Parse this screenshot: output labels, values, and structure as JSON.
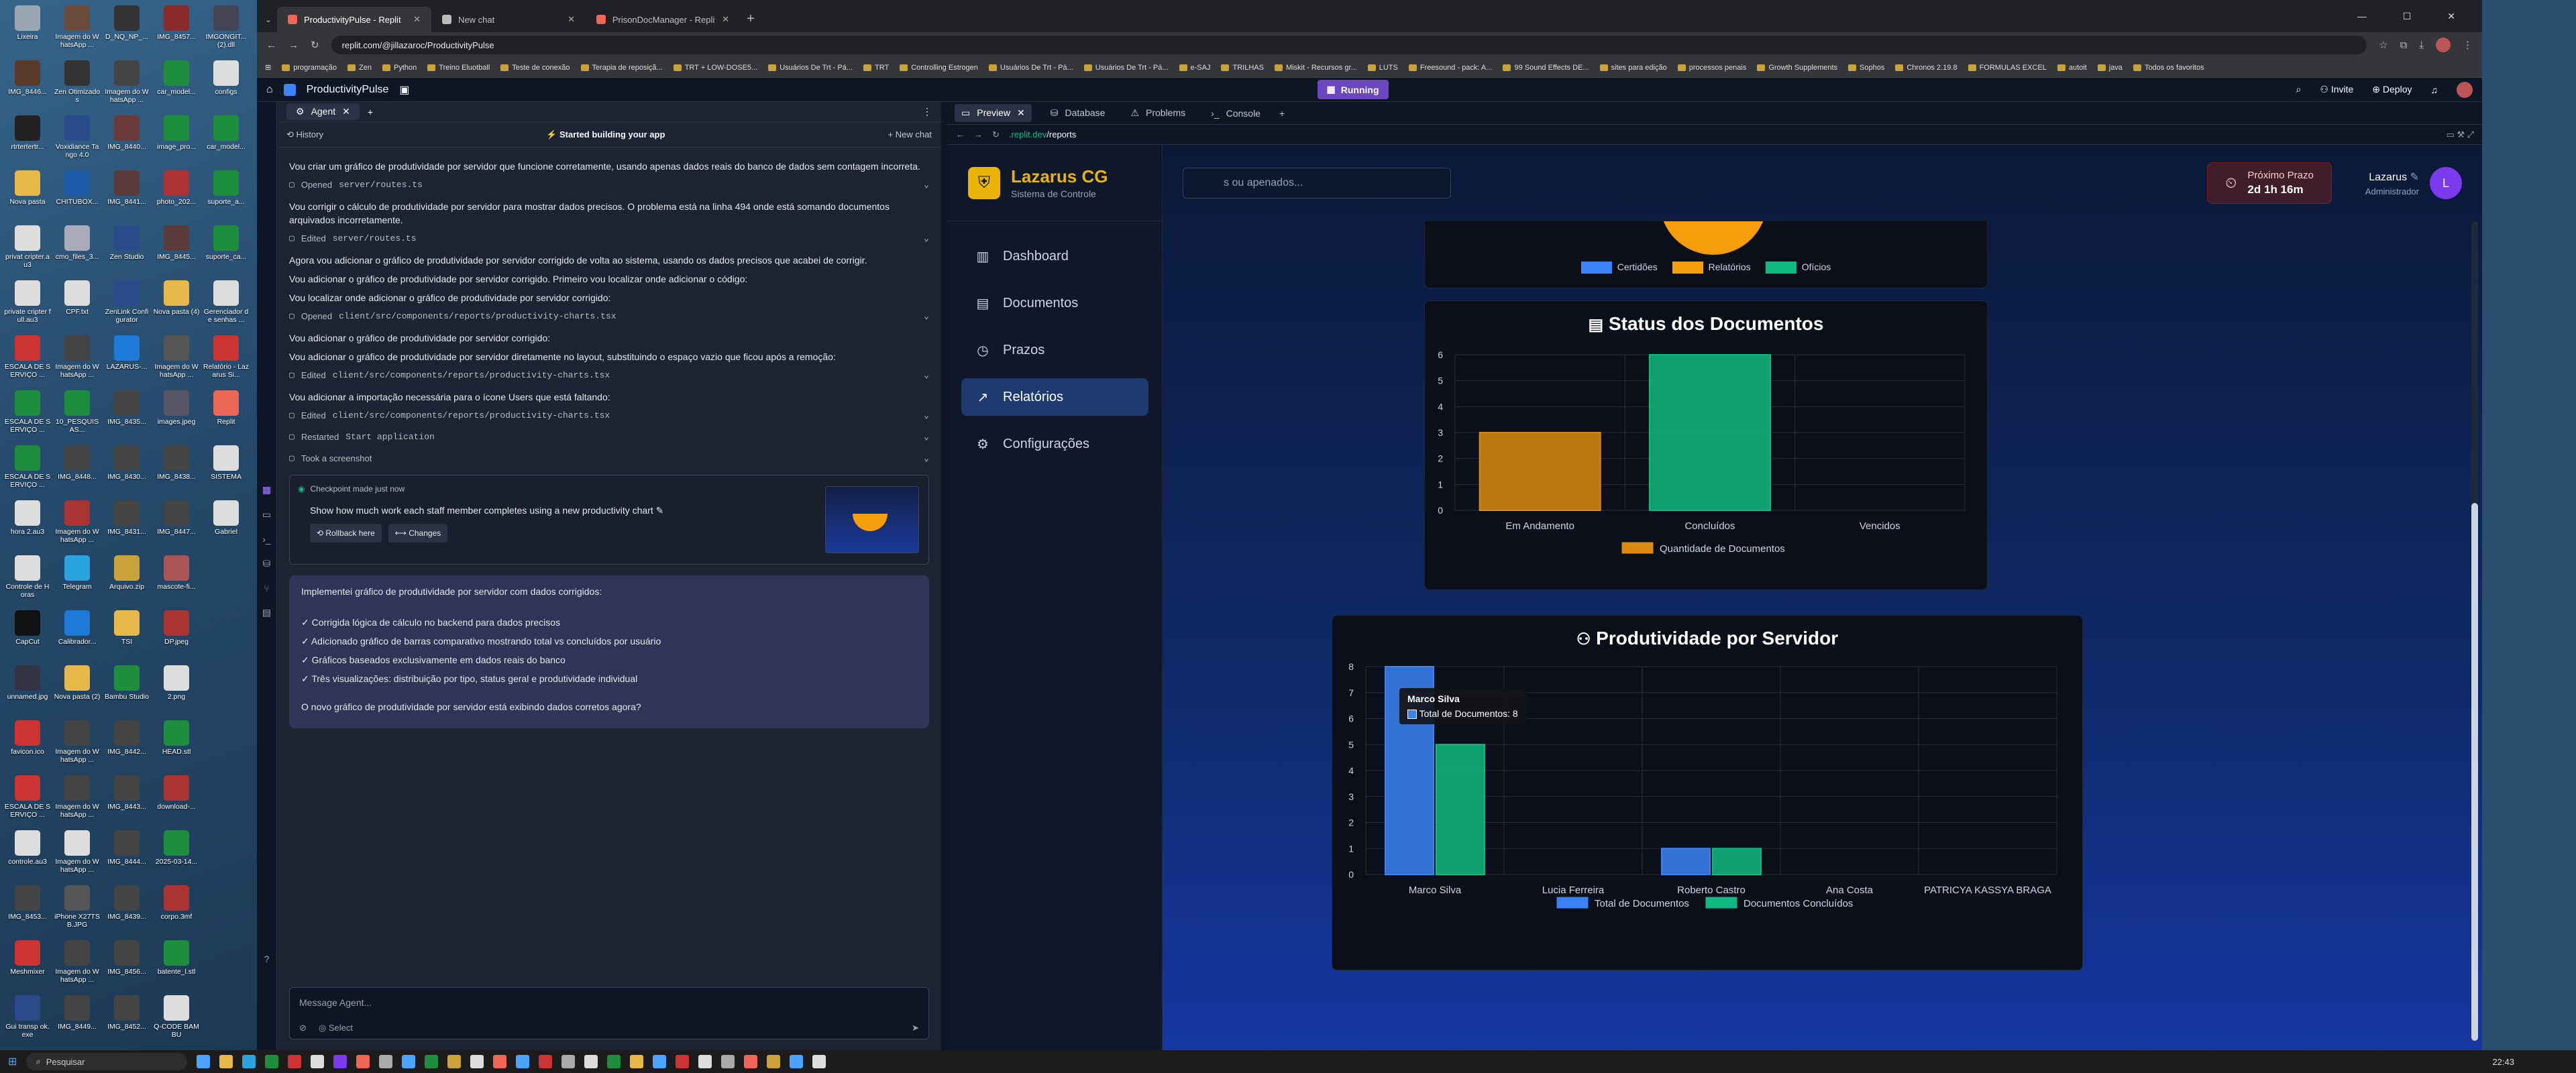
{
  "desktop": {
    "icons": [
      {
        "label": "Lixeira",
        "color": "#9aa7b3"
      },
      {
        "label": "Imagem do WhatsApp ...",
        "color": "#6b4b3a"
      },
      {
        "label": "D_NQ_NP_...",
        "color": "#333"
      },
      {
        "label": "IMG_8457...",
        "color": "#8a2a2a"
      },
      {
        "label": "IMGONGIT... (2).dll",
        "color": "#445"
      },
      {
        "label": "IMG_8446...",
        "color": "#5a3a2a"
      },
      {
        "label": "Zen Otimizados",
        "color": "#333"
      },
      {
        "label": "Imagem do WhatsApp ...",
        "color": "#444"
      },
      {
        "label": "car_model...",
        "color": "#1e8e3e"
      },
      {
        "label": "configs",
        "color": "#ddd"
      },
      {
        "label": "rtrtertertr...",
        "color": "#222"
      },
      {
        "label": "Voxidiance Tango 4.0",
        "color": "#2a4a8a"
      },
      {
        "label": "IMG_8440...",
        "color": "#6a3a3a"
      },
      {
        "label": "image_pro...",
        "color": "#1e8e3e"
      },
      {
        "label": "car_model...",
        "color": "#1e8e3e"
      },
      {
        "label": "Nova pasta",
        "color": "#e6b84a"
      },
      {
        "label": "CHITUBOX...",
        "color": "#1e5aa8"
      },
      {
        "label": "IMG_8441...",
        "color": "#5a3a3a"
      },
      {
        "label": "photo_202...",
        "color": "#a33"
      },
      {
        "label": "suporte_a...",
        "color": "#1e8e3e"
      },
      {
        "label": "privat cripter.au3",
        "color": "#ddd"
      },
      {
        "label": "cmo_files_3...",
        "color": "#aab"
      },
      {
        "label": "Zen Studio",
        "color": "#2a4a8a"
      },
      {
        "label": "IMG_8445...",
        "color": "#5a3a3a"
      },
      {
        "label": "suporte_ca...",
        "color": "#1e8e3e"
      },
      {
        "label": "private cripter full.au3",
        "color": "#ddd"
      },
      {
        "label": "CPF.txt",
        "color": "#ddd"
      },
      {
        "label": "ZenLink Configurator",
        "color": "#2a4a8a"
      },
      {
        "label": "Nova pasta (4)",
        "color": "#e6b84a"
      },
      {
        "label": "Gerenciador de senhas ...",
        "color": "#ddd"
      },
      {
        "label": "ESCALA DE SERVIÇO ...",
        "color": "#c33"
      },
      {
        "label": "Imagem do WhatsApp ...",
        "color": "#444"
      },
      {
        "label": "LAZARUS-...",
        "color": "#1e7ad8"
      },
      {
        "label": "Imagem do WhatsApp ...",
        "color": "#555"
      },
      {
        "label": "Relatório - Lazarus Si...",
        "color": "#c33"
      },
      {
        "label": "ESCALA DE SERVIÇO ...",
        "color": "#1e8e3e"
      },
      {
        "label": "10_PESQUISAS...",
        "color": "#1e8e3e"
      },
      {
        "label": "IMG_8435...",
        "color": "#444"
      },
      {
        "label": "images.jpeg",
        "color": "#556"
      },
      {
        "label": "Replit",
        "color": "#e65"
      },
      {
        "label": "ESCALA DE SERVIÇO ...",
        "color": "#1e8e3e"
      },
      {
        "label": "IMG_8448...",
        "color": "#444"
      },
      {
        "label": "IMG_8430...",
        "color": "#444"
      },
      {
        "label": "IMG_8438...",
        "color": "#444"
      },
      {
        "label": "SISTEMA",
        "color": "#ddd"
      },
      {
        "label": "hora 2.au3",
        "color": "#ddd"
      },
      {
        "label": "Imagem do WhatsApp ...",
        "color": "#a33"
      },
      {
        "label": "IMG_8431...",
        "color": "#444"
      },
      {
        "label": "IMG_8447...",
        "color": "#444"
      },
      {
        "label": "Gabriel",
        "color": "#ddd"
      },
      {
        "label": "Controle de Horas",
        "color": "#ddd"
      },
      {
        "label": "Telegram",
        "color": "#2aa3e0"
      },
      {
        "label": "Arquivo.zip",
        "color": "#c9a33a"
      },
      {
        "label": "mascote-fi...",
        "color": "#a55"
      },
      {
        "label": "",
        "color": "transparent"
      },
      {
        "label": "CapCut",
        "color": "#111"
      },
      {
        "label": "Calibrador...",
        "color": "#1e7ad8"
      },
      {
        "label": "TSI",
        "color": "#e6b84a"
      },
      {
        "label": "DP.jpeg",
        "color": "#a33"
      },
      {
        "label": "",
        "color": "transparent"
      },
      {
        "label": "unnamed.jpg",
        "color": "#334"
      },
      {
        "label": "Nova pasta (2)",
        "color": "#e6b84a"
      },
      {
        "label": "Bambu Studio",
        "color": "#1e8e3e"
      },
      {
        "label": "2.png",
        "color": "#ddd"
      },
      {
        "label": "",
        "color": "transparent"
      },
      {
        "label": "favicon.ico",
        "color": "#c33"
      },
      {
        "label": "Imagem do WhatsApp ...",
        "color": "#444"
      },
      {
        "label": "IMG_8442...",
        "color": "#444"
      },
      {
        "label": "HEAD.stl",
        "color": "#1e8e3e"
      },
      {
        "label": "",
        "color": "transparent"
      },
      {
        "label": "ESCALA DE SERVIÇO ...",
        "color": "#c33"
      },
      {
        "label": "Imagem do WhatsApp ...",
        "color": "#444"
      },
      {
        "label": "IMG_8443...",
        "color": "#444"
      },
      {
        "label": "download-...",
        "color": "#a33"
      },
      {
        "label": "",
        "color": "transparent"
      },
      {
        "label": "controle.au3",
        "color": "#ddd"
      },
      {
        "label": "Imagem do WhatsApp ...",
        "color": "#ddd"
      },
      {
        "label": "IMG_8444...",
        "color": "#444"
      },
      {
        "label": "2025-03-14...",
        "color": "#1e8e3e"
      },
      {
        "label": "",
        "color": "transparent"
      },
      {
        "label": "IMG_8453...",
        "color": "#444"
      },
      {
        "label": "iPhone X27TSB.JPG",
        "color": "#555"
      },
      {
        "label": "IMG_8439...",
        "color": "#444"
      },
      {
        "label": "corpo.3mf",
        "color": "#a33"
      },
      {
        "label": "",
        "color": "transparent"
      },
      {
        "label": "Meshmixer",
        "color": "#c33"
      },
      {
        "label": "Imagem do WhatsApp ...",
        "color": "#444"
      },
      {
        "label": "IMG_8456...",
        "color": "#444"
      },
      {
        "label": "batente_l.stl",
        "color": "#1e8e3e"
      },
      {
        "label": "",
        "color": "transparent"
      },
      {
        "label": "Gui transp ok.exe",
        "color": "#2a4a8a"
      },
      {
        "label": "IMG_8449...",
        "color": "#444"
      },
      {
        "label": "IMG_8452...",
        "color": "#444"
      },
      {
        "label": "Q-CODE BAMBU",
        "color": "#ddd"
      },
      {
        "label": "",
        "color": "transparent"
      }
    ]
  },
  "browser": {
    "tabs": [
      {
        "title": "ProductivityPulse - Replit",
        "active": true
      },
      {
        "title": "New chat",
        "active": false
      },
      {
        "title": "PrisonDocManager - Replit",
        "active": false
      }
    ],
    "url": "replit.com/@jillazaroc/ProductivityPulse",
    "bookmarks": [
      "programação",
      "Zen",
      "Python",
      "Treino Eluotball",
      "Teste de conexão",
      "Terapia de reposiçã...",
      "TRT + LOW-DOSE5...",
      "Usuários De Trt - Pá...",
      "TRT",
      "Controlling Estrogen",
      "Usuários De Trt - Pá...",
      "Usuários De Trt - Pá...",
      "e-SAJ",
      "TRILHAS",
      "Miskit - Recursos gr...",
      "LUTS",
      "Freesound - pack: A...",
      "99 Sound Effects DE...",
      "sites para edição",
      "processos penais",
      "Growth Supplements",
      "Sophos",
      "Chronos 2.19.8",
      "FORMULAS EXCEL",
      "autoit",
      "java",
      "Todos os favoritos"
    ]
  },
  "replit": {
    "project": "ProductivityPulse",
    "running_label": "Running",
    "invite_label": "Invite",
    "deploy_label": "Deploy",
    "agent_tab": "Agent",
    "history_label": "History",
    "status_label": "Started building your app",
    "new_chat_label": "New chat",
    "messages": [
      {
        "type": "text",
        "text": "Vou criar um gráfico de produtividade por servidor que funcione corretamente, usando apenas dados reais do banco de dados sem contagem incorreta."
      },
      {
        "type": "file",
        "verb": "Opened",
        "path": "server/routes.ts"
      },
      {
        "type": "text",
        "text": "Vou corrigir o cálculo de produtividade por servidor para mostrar dados precisos. O problema está na linha 494 onde está somando documentos arquivados incorretamente."
      },
      {
        "type": "file",
        "verb": "Edited",
        "path": "server/routes.ts"
      },
      {
        "type": "text",
        "text": "Agora vou adicionar o gráfico de produtividade por servidor corrigido de volta ao sistema, usando os dados precisos que acabei de corrigir."
      },
      {
        "type": "text",
        "text": "Vou adicionar o gráfico de produtividade por servidor corrigido. Primeiro vou localizar onde adicionar o código:"
      },
      {
        "type": "text",
        "text": "Vou localizar onde adicionar o gráfico de produtividade por servidor corrigido:"
      },
      {
        "type": "file",
        "verb": "Opened",
        "path": "client/src/components/reports/productivity-charts.tsx"
      },
      {
        "type": "text",
        "text": "Vou adicionar o gráfico de produtividade por servidor corrigido:"
      },
      {
        "type": "text",
        "text": "Vou adicionar o gráfico de produtividade por servidor diretamente no layout, substituindo o espaço vazio que ficou após a remoção:"
      },
      {
        "type": "file",
        "verb": "Edited",
        "path": "client/src/components/reports/productivity-charts.tsx"
      },
      {
        "type": "text",
        "text": "Vou adicionar a importação necessária para o ícone Users que está faltando:"
      },
      {
        "type": "file",
        "verb": "Edited",
        "path": "client/src/components/reports/productivity-charts.tsx"
      },
      {
        "type": "file",
        "verb": "Restarted",
        "path": "Start application"
      },
      {
        "type": "file",
        "verb": "",
        "path": "Took a screenshot"
      }
    ],
    "checkpoint": {
      "header": "Checkpoint made just now",
      "description": "Show how much work each staff member completes using a new productivity chart",
      "rollback_label": "Rollback here",
      "changes_label": "Changes"
    },
    "summary": {
      "title": "Implementei gráfico de produtividade por servidor com dados corrigidos:",
      "items": [
        "✓ Corrigida lógica de cálculo no backend para dados precisos",
        "✓ Adicionado gráfico de barras comparativo mostrando total vs concluídos por usuário",
        "✓ Gráficos baseados exclusivamente em dados reais do banco",
        "✓ Três visualizações: distribuição por tipo, status geral e produtividade individual"
      ],
      "question": "O novo gráfico de produtividade por servidor está exibindo dados corretos agora?"
    },
    "input_placeholder": "Message Agent...",
    "select_label": "Select",
    "preview_tabs": [
      "Preview",
      "Database",
      "Problems",
      "Console"
    ],
    "preview_url_host": ".replit.dev",
    "preview_url_path": "/reports"
  },
  "app": {
    "brand": "Lazarus CG",
    "brand_sub": "Sistema de Controle",
    "nav": [
      {
        "label": "Dashboard",
        "icon": "bar-chart-icon",
        "active": false
      },
      {
        "label": "Documentos",
        "icon": "document-icon",
        "active": false
      },
      {
        "label": "Prazos",
        "icon": "clock-icon",
        "active": false
      },
      {
        "label": "Relatórios",
        "icon": "trending-up-icon",
        "active": true
      },
      {
        "label": "Configurações",
        "icon": "gear-icon",
        "active": false
      }
    ],
    "search_placeholder": "s ou apenados...",
    "prazo_label": "Próximo Prazo",
    "prazo_value": "2d 1h 16m",
    "user_name": "Lazarus",
    "user_role": "Administrador",
    "avatar_letter": "L",
    "top_legend": [
      "Certidões",
      "Relatórios",
      "Ofícios"
    ],
    "colors": {
      "blue": "#3b82f6",
      "orange": "#f59e0b",
      "green": "#10b981"
    }
  },
  "chart_data": [
    {
      "type": "bar",
      "title": "Status dos Documentos",
      "categories": [
        "Em Andamento",
        "Concluídos",
        "Vencidos"
      ],
      "series": [
        {
          "name": "Quantidade de Documentos",
          "values": [
            3,
            6,
            0
          ]
        }
      ],
      "bar_colors": [
        "#d98a0f",
        "#10b981",
        "#d98a0f"
      ],
      "ylim": [
        0,
        6
      ],
      "yticks": [
        0,
        1,
        2,
        3,
        4,
        5,
        6
      ],
      "grid": true,
      "legend": "bottom"
    },
    {
      "type": "bar",
      "title": "Produtividade por Servidor",
      "categories": [
        "Marco Silva",
        "Lucia Ferreira",
        "Roberto Castro",
        "Ana Costa",
        "PATRICYA KASSYA BRAGA"
      ],
      "series": [
        {
          "name": "Total de Documentos",
          "values": [
            8,
            0,
            1,
            0,
            0
          ],
          "color": "#3b82f6"
        },
        {
          "name": "Documentos Concluídos",
          "values": [
            5,
            0,
            1,
            0,
            0
          ],
          "color": "#10b981"
        }
      ],
      "ylim": [
        0,
        8
      ],
      "yticks": [
        0,
        1,
        2,
        3,
        4,
        5,
        6,
        7,
        8
      ],
      "grid": true,
      "legend": "bottom",
      "tooltip": {
        "title": "Marco Silva",
        "line": "Total de Documentos: 8"
      }
    }
  ],
  "taskbar": {
    "search_label": "Pesquisar",
    "time": "22:43"
  }
}
